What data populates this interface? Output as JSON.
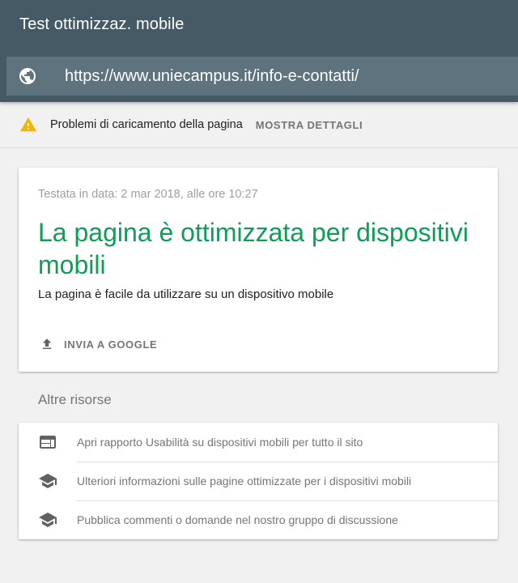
{
  "header": {
    "title": "Test ottimizzaz. mobile",
    "url": "https://www.uniecampus.it/info-e-contatti/",
    "url_icon": "globe-icon"
  },
  "warning": {
    "icon": "warning-icon",
    "text": "Problemi di caricamento della pagina",
    "action_label": "MOSTRA DETTAGLI"
  },
  "result": {
    "tested_date": "Testata in data: 2 mar 2018, alle ore 10:27",
    "title": "La pagina è ottimizzata per dispositivi mobili",
    "subtitle": "La pagina è facile da utilizzare su un dispositivo mobile",
    "submit_label": "INVIA A GOOGLE",
    "submit_icon": "upload-icon"
  },
  "resources": {
    "title": "Altre risorse",
    "items": [
      {
        "icon": "web-icon",
        "label": "Apri rapporto Usabilità su dispositivi mobili per tutto il sito"
      },
      {
        "icon": "school-icon",
        "label": "Ulteriori informazioni sulle pagine ottimizzate per i dispositivi mobili"
      },
      {
        "icon": "school-icon",
        "label": "Pubblica commenti o domande nel nostro gruppo di discussione"
      }
    ]
  },
  "colors": {
    "header_bg": "#455a64",
    "url_bar_bg": "#5e737d",
    "success_green": "#0f9d58",
    "warning_yellow": "#f4b400",
    "page_bg": "#f1f1f1"
  }
}
